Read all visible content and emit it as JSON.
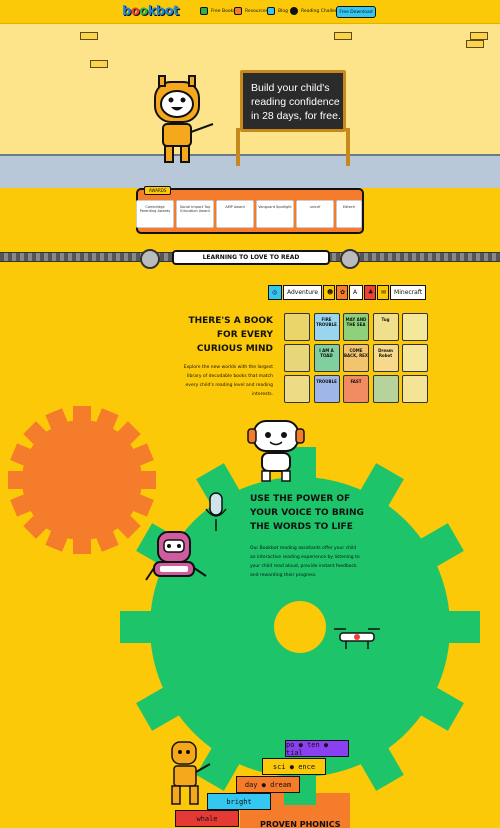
{
  "nav": {
    "logo_parts": [
      "b",
      "o",
      "o",
      "kbot"
    ],
    "items": [
      {
        "label": "Free Books",
        "icon": "book-icon"
      },
      {
        "label": "Resources",
        "icon": "resources-icon"
      },
      {
        "label": "Blog",
        "icon": "blog-icon"
      },
      {
        "label": "Reading Challenge",
        "icon": "challenge-icon"
      }
    ],
    "download_label": "Free Download"
  },
  "hero": {
    "headline": "Build your child's reading confidence in 28 days, for free."
  },
  "awards": {
    "tag": "AWARDS",
    "cards": [
      {
        "label": "Cambridge Parenting Awards"
      },
      {
        "label": "Social Impact Top Education Award"
      },
      {
        "label": "AMP Award"
      },
      {
        "label": "Vanguard Spotlight"
      },
      {
        "label": "unicef"
      },
      {
        "label": "Edtech"
      }
    ]
  },
  "banner": {
    "label": "LEARNING TO LOVE TO READ"
  },
  "genres": {
    "tabs": [
      "Adventure",
      "A",
      "Minecraft"
    ]
  },
  "books_section": {
    "title": "THERE'S A BOOK FOR EVERY CURIOUS MIND",
    "description": "Explore the new worlds with the largest library of decodable books that match every child's reading level and reading interests.",
    "books": [
      {
        "title": "",
        "color": "#e9d56a"
      },
      {
        "title": "FIRE TROUBLE",
        "color": "#9ad5ef"
      },
      {
        "title": "MAY AND THE SEA",
        "color": "#8fd17a"
      },
      {
        "title": "Tug",
        "color": "#f0e08b"
      },
      {
        "title": "",
        "color": "#f4e89a"
      },
      {
        "title": "",
        "color": "#e7d778"
      },
      {
        "title": "I AM A TOAD",
        "color": "#7fcf9f"
      },
      {
        "title": "COME BACK, REX",
        "color": "#f2c46d"
      },
      {
        "title": "Dream Robot",
        "color": "#f6d98a"
      },
      {
        "title": "",
        "color": "#f5e89c"
      },
      {
        "title": "",
        "color": "#eedb86"
      },
      {
        "title": "TROUBLE",
        "color": "#9fb7e8"
      },
      {
        "title": "FAST",
        "color": "#f08b62"
      },
      {
        "title": "",
        "color": "#b5d39a"
      },
      {
        "title": "",
        "color": "#f4e596"
      }
    ]
  },
  "voice_section": {
    "title": "USE THE POWER OF YOUR VOICE TO BRING THE WORDS TO LIFE",
    "description": "Our Bookbot reading assistants offer your child an interactive reading experience by listening to your child read aloud, provide instant feedback and rewarding their progress."
  },
  "phonics": {
    "steps": [
      {
        "text": "po ● ten ● tial",
        "color": "#8a3ff0"
      },
      {
        "text": "sci ● ence",
        "color": "#fcc908"
      },
      {
        "text": "day ● dream",
        "color": "#f47c2a"
      },
      {
        "text": "bright",
        "color": "#33c7f2"
      },
      {
        "text": "whale",
        "color": "#e53935"
      }
    ],
    "label": "PROVEN PHONICS"
  },
  "colors": {
    "background": "#fcc908",
    "accent_orange": "#f47c2a",
    "accent_green": "#1dc46a",
    "accent_blue": "#33c7f2"
  }
}
